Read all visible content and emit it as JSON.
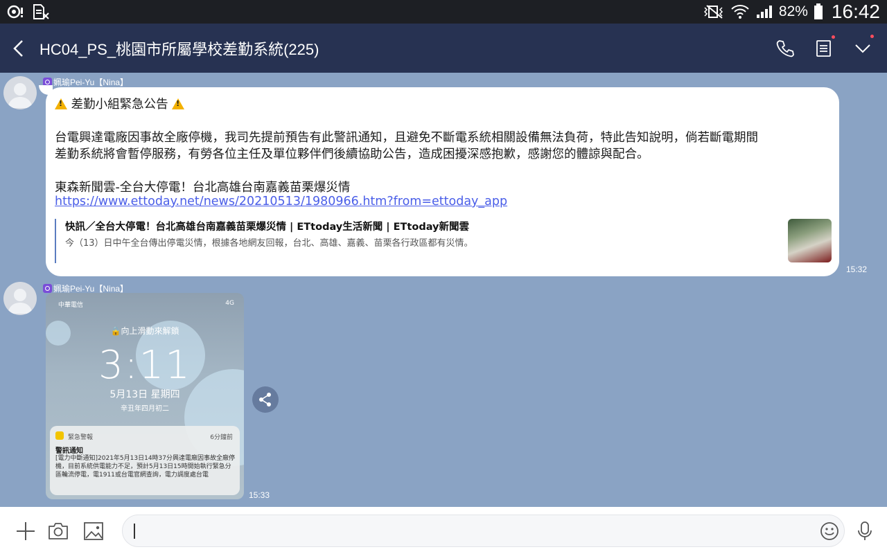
{
  "status_bar": {
    "battery_pct": "82%",
    "time": "16:42",
    "icons": [
      "settings-sync-icon",
      "sim-disabled-icon",
      "vibrate-icon",
      "wifi-icon",
      "signal-icon",
      "battery-icon"
    ]
  },
  "header": {
    "title": "HC04_PS_桃園市所屬學校差勤系統(225)",
    "icons": [
      "back-arrow-icon",
      "phone-icon",
      "notes-icon",
      "chevron-down-icon"
    ]
  },
  "messages": [
    {
      "sender": "姵瑜Pei-Yu【Nina】",
      "lines": [
        "差勤小組緊急公告",
        "台電興達電廠因事故全廠停機，我司先提前預告有此警訊通知，且避免不斷電系統相關設備無法負荷，特此告知說明，倘若斷電期間",
        "差勤系統將會暫停服務，有勞各位主任及單位夥伴們後續協助公告，造成困擾深感抱歉，感謝您的體諒與配合。",
        "東森新聞雲-全台大停電！台北高雄台南嘉義苗栗爆災情"
      ],
      "link": "https://www.ettoday.net/news/20210513/1980966.htm?from=ettoday_app",
      "preview": {
        "title": "快訊／全台大停電！台北高雄台南嘉義苗栗爆災情 | ETtoday生活新聞 | ETtoday新聞雲",
        "description": "今（13）日中午全台傳出停電災情，根據各地網友回報，台北、高雄、嘉義、苗栗各行政區都有災情。"
      },
      "time": "15:32"
    },
    {
      "sender": "姵瑜Pei-Yu【Nina】",
      "image": {
        "carrier": "中華電信",
        "network": "4G",
        "unlock_hint": "向上滑動來解鎖",
        "clock": "3:11",
        "date": "5月13日 星期四",
        "lunar": "辛丑年四月初二",
        "alert_app": "緊急警報",
        "alert_ago": "6分鐘前",
        "alert_title": "警訊通知",
        "alert_body": "[電力中斷通知]2021年5月13日14時37分興達電廠因事故全廠停機，目前系統供電能力不足，預計5月13日15時開始執行緊急分區輪流停電，電1911或台電官網查詢，電力調度處台電"
      },
      "time": "15:33"
    }
  ],
  "input_bar": {
    "icons": [
      "plus-icon",
      "camera-icon",
      "image-icon",
      "emoji-icon",
      "microphone-icon"
    ],
    "placeholder": ""
  },
  "colors": {
    "chat_bg": "#8aa3c4",
    "header_bg": "#273252",
    "link": "#4a5ee8"
  }
}
